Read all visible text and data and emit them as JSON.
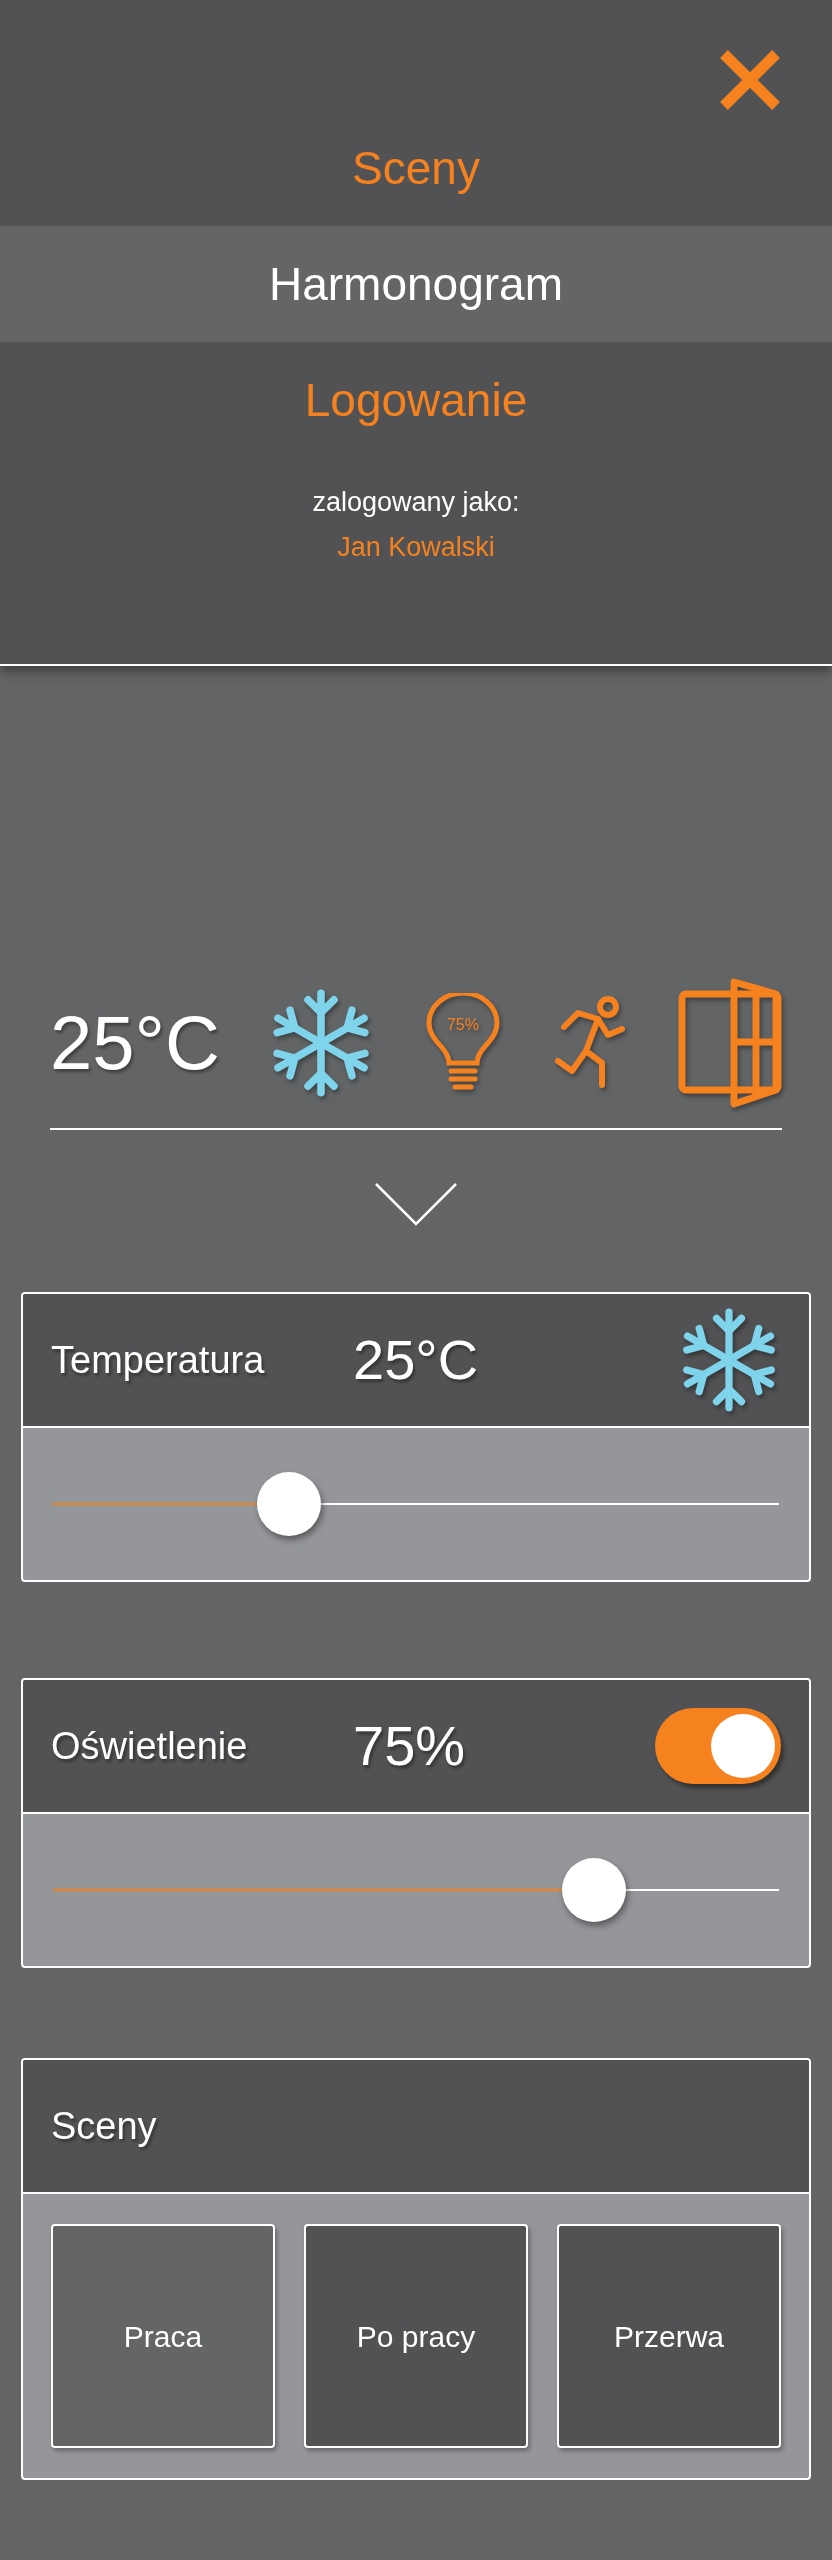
{
  "menu": {
    "items": [
      {
        "label": "Sceny",
        "selected": false
      },
      {
        "label": "Harmonogram",
        "selected": true
      },
      {
        "label": "Logowanie",
        "selected": false
      }
    ],
    "login_caption": "zalogowany jako:",
    "user": "Jan Kowalski"
  },
  "status": {
    "temperature": "25°C",
    "light_reading": "75%"
  },
  "cards": [
    {
      "title": "Temperatura",
      "value": "25°C",
      "kind": "cooling",
      "level": 0.325
    },
    {
      "title": "Oświetlenie",
      "value": "75%",
      "kind": "toggle",
      "on": true,
      "level": 0.745
    }
  ],
  "scenes": {
    "title": "Sceny",
    "items": [
      {
        "label": "Praca",
        "selected": true
      },
      {
        "label": "Po pracy",
        "selected": false
      },
      {
        "label": "Przerwa",
        "selected": false
      }
    ]
  }
}
